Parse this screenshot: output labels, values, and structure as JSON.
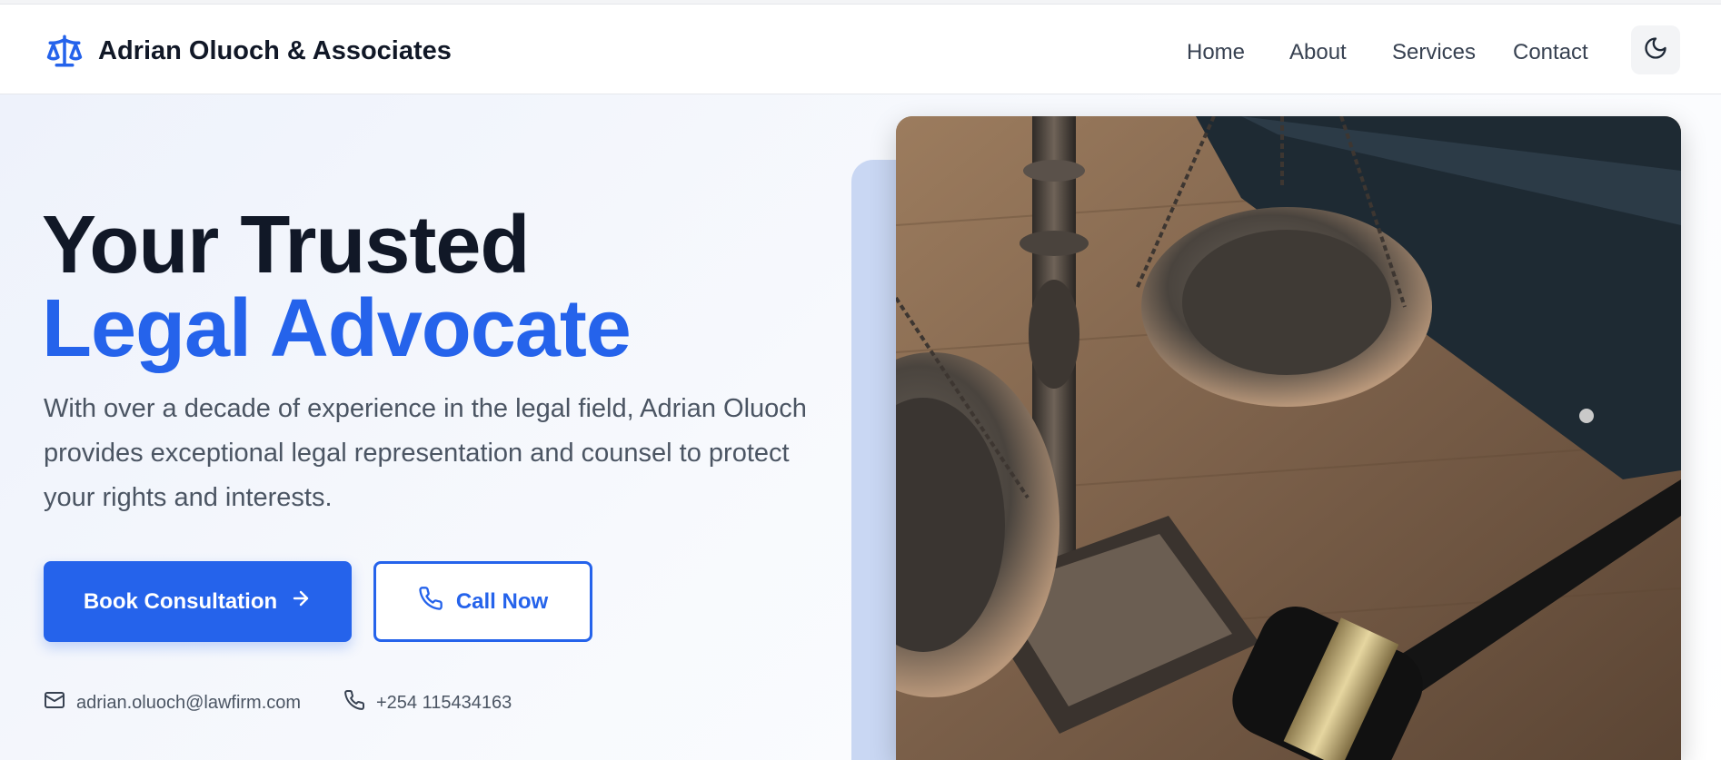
{
  "brand": {
    "name": "Adrian Oluoch & Associates",
    "logo_icon": "scales-of-justice-icon",
    "accent_color": "#2563eb"
  },
  "nav": {
    "items": [
      {
        "label": "Home"
      },
      {
        "label": "About"
      },
      {
        "label": "Services"
      },
      {
        "label": "Contact"
      }
    ],
    "theme_toggle_icon": "moon-icon"
  },
  "hero": {
    "headline_line1": "Your Trusted",
    "headline_line2": "Legal Advocate",
    "lead": "With over a decade of experience in the legal field, Adrian Oluoch provides exceptional legal representation and counsel to protect your rights and interests.",
    "primary_button": {
      "label": "Book Consultation",
      "icon": "arrow-right-icon"
    },
    "secondary_button": {
      "label": "Call Now",
      "icon": "phone-icon"
    },
    "email": {
      "icon": "mail-icon",
      "value": "adrian.oluoch@lawfirm.com"
    },
    "phone": {
      "icon": "phone-icon",
      "value": "+254 115434163"
    },
    "image": {
      "subject": "scales-of-justice-and-gavel-photo"
    }
  },
  "colors": {
    "heading": "#111827",
    "accent": "#2563eb",
    "body_text": "#4b5563"
  }
}
